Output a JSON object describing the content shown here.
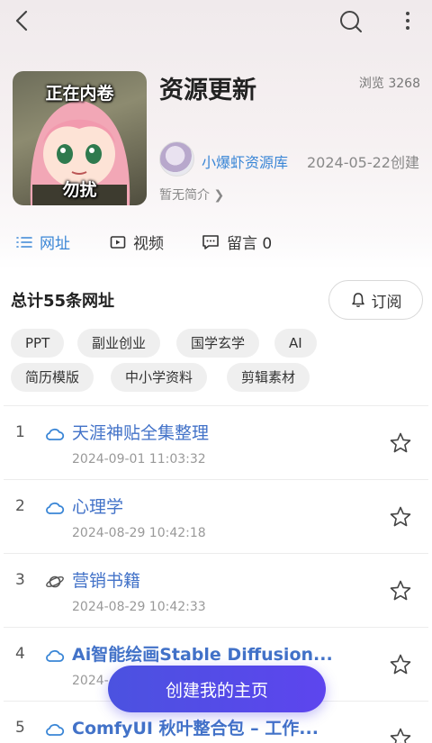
{
  "header": {
    "back_icon": "back-arrow-icon",
    "search_icon": "search-icon",
    "more_icon": "more-vertical-icon"
  },
  "cover": {
    "overlay_top": "正在内卷",
    "overlay_bottom": "勿扰"
  },
  "title": "资源更新",
  "views": "浏览 3268",
  "author": {
    "name": "小爆虾资源库"
  },
  "created": "2024-05-22创建",
  "intro": "暂无简介",
  "tabs": [
    {
      "label": "网址",
      "icon": "list-icon",
      "active": true
    },
    {
      "label": "视频",
      "icon": "video-icon",
      "active": false
    },
    {
      "label": "留言 0",
      "icon": "comment-icon",
      "active": false
    }
  ],
  "summary": "总计55条网址",
  "subscribe_label": "订阅",
  "chips": [
    "PPT",
    "副业创业",
    "国学玄学",
    "AI",
    "简历模版",
    "中小学资料",
    "剪辑素材"
  ],
  "items": [
    {
      "num": "1",
      "title": "天涯神贴全集整理",
      "date": "2024-09-01 11:03:32",
      "icon": "cloud-icon",
      "bold": false
    },
    {
      "num": "2",
      "title": "心理学",
      "date": "2024-08-29 10:42:18",
      "icon": "cloud-icon",
      "bold": false
    },
    {
      "num": "3",
      "title": "营销书籍",
      "date": "2024-08-29 10:42:33",
      "icon": "planet-icon",
      "bold": false
    },
    {
      "num": "4",
      "title": "Ai智能绘画Stable Diffusion...",
      "date": "2024-",
      "icon": "cloud-icon",
      "bold": true
    },
    {
      "num": "5",
      "title": "ComfyUI 秋叶整合包 – 工作...",
      "date": "",
      "icon": "cloud-icon",
      "bold": true
    }
  ],
  "cta_label": "创建我的主页",
  "colors": {
    "accent": "#3a86d6",
    "link": "#4272c8",
    "cta": "#5548e8"
  }
}
